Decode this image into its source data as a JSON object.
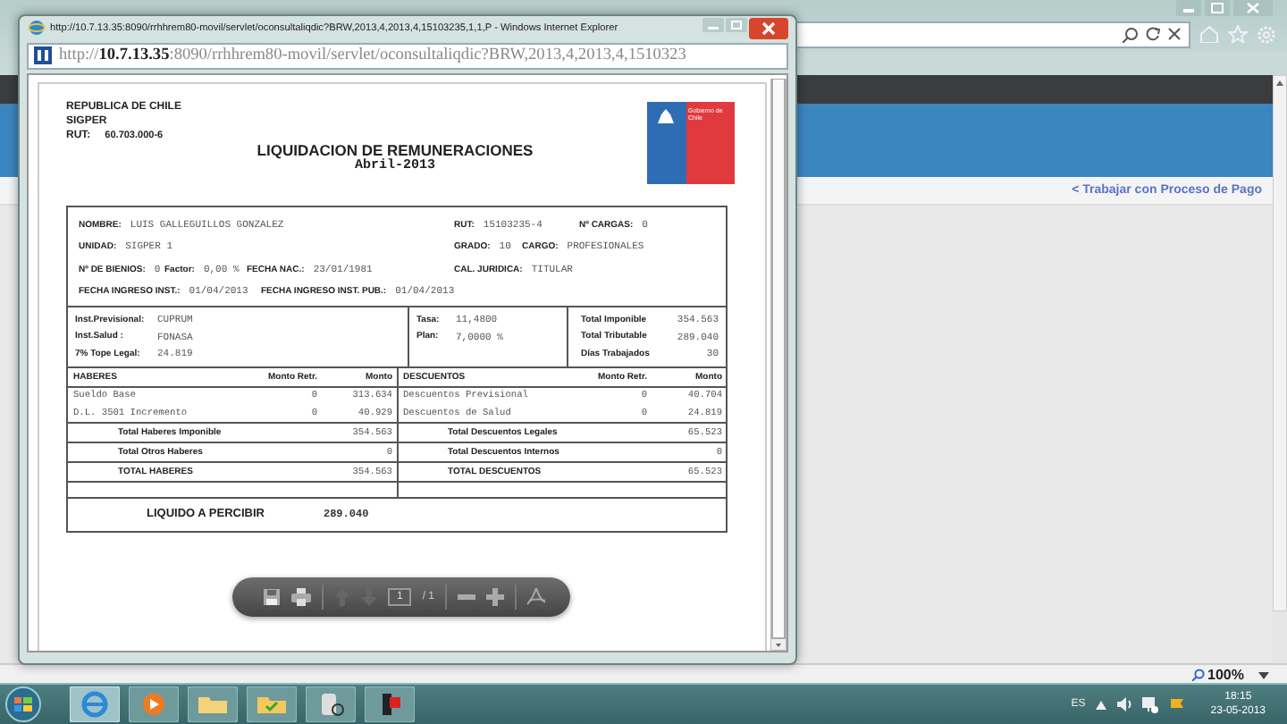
{
  "background_window": {
    "link": "< Trabajar con Proceso de Pago",
    "zoom": "100%"
  },
  "popup_window": {
    "title": "http://10.7.13.35:8090/rrhhrem80-movil/servlet/oconsultaliqdic?BRW,2013,4,2013,4,15103235,1,1,P - Windows Internet Explorer",
    "address": "http://**10.7.13.35**:8090/rrhhrem80-movil/servlet/oconsultaliqdic?BRW,2013,4,2013,4,1510323"
  },
  "document": {
    "header_lines": [
      "REPUBLICA DE CHILE",
      "SIGPER"
    ],
    "rut_label": "RUT:",
    "rut_value": "60.703.000-6",
    "title": "LIQUIDACION DE REMUNERACIONES",
    "period": "Abril-2013",
    "logo_text": "Gobierno de Chile",
    "info_rows": [
      [
        {
          "label": "NOMBRE:",
          "value": "LUIS GALLEGUILLOS GONZALEZ"
        },
        {
          "label": "RUT:",
          "value": "15103235-4"
        },
        {
          "label": "Nº CARGAS:",
          "value": "0"
        }
      ],
      [
        {
          "label": "UNIDAD:",
          "value": "SIGPER 1"
        },
        {
          "label": "GRADO:",
          "value": "10"
        },
        {
          "label": "CARGO:",
          "value": "PROFESIONALES"
        }
      ],
      [
        {
          "label": "Nº DE BIENIOS:",
          "value": "0"
        },
        {
          "label": "Factor:",
          "value": "0,00 %"
        },
        {
          "label": "FECHA NAC.:",
          "value": "23/01/1981"
        },
        {
          "label": "CAL. JURIDICA:",
          "value": "TITULAR"
        }
      ],
      [
        {
          "label": "FECHA INGRESO INST.:",
          "value": "01/04/2013"
        },
        {
          "label": "FECHA INGRESO INST. PUB.:",
          "value": "01/04/2013"
        }
      ]
    ],
    "institutions": [
      {
        "label": "Inst.Previsional:",
        "value": "CUPRUM"
      },
      {
        "label": "Inst.Salud :",
        "value": "FONASA"
      },
      {
        "label": "7% Tope Legal:",
        "value": "24.819"
      }
    ],
    "rates": [
      {
        "label": "Tasa:",
        "value": "11,4800"
      },
      {
        "label": "Plan:",
        "value": "7,0000 %"
      }
    ],
    "summary": [
      {
        "label": "Total Imponible",
        "value": "354.563"
      },
      {
        "label": "Total Tributable",
        "value": "289.040"
      },
      {
        "label": "Días Trabajados",
        "value": "30"
      }
    ],
    "haberes": {
      "columns": [
        "HABERES",
        "Monto Retr.",
        "Monto"
      ],
      "items": [
        [
          "Sueldo Base",
          "0",
          "313.634"
        ],
        [
          "D.L. 3501 Incremento",
          "0",
          "40.929"
        ]
      ],
      "totals": [
        {
          "label": "Total Haberes Imponible",
          "value": "354.563"
        },
        {
          "label": "Total Otros Haberes",
          "value": "0"
        },
        {
          "label": "TOTAL HABERES",
          "value": "354.563"
        }
      ]
    },
    "descuentos": {
      "columns": [
        "DESCUENTOS",
        "Monto Retr.",
        "Monto"
      ],
      "items": [
        [
          "Descuentos Previsional",
          "0",
          "40.704"
        ],
        [
          "Descuentos de Salud",
          "0",
          "24.819"
        ]
      ],
      "totals": [
        {
          "label": "Total Descuentos Legales",
          "value": "65.523"
        },
        {
          "label": "Total Descuentos Internos",
          "value": "0"
        },
        {
          "label": "TOTAL DESCUENTOS",
          "value": "65.523"
        }
      ]
    },
    "net": {
      "label": "LIQUIDO A PERCIBIR",
      "value": "289.040"
    }
  },
  "pdf_toolbar": {
    "page": "1",
    "total": "/ 1"
  },
  "taskbar": {
    "language": "ES",
    "time": "18:15",
    "date": "23-05-2013"
  }
}
